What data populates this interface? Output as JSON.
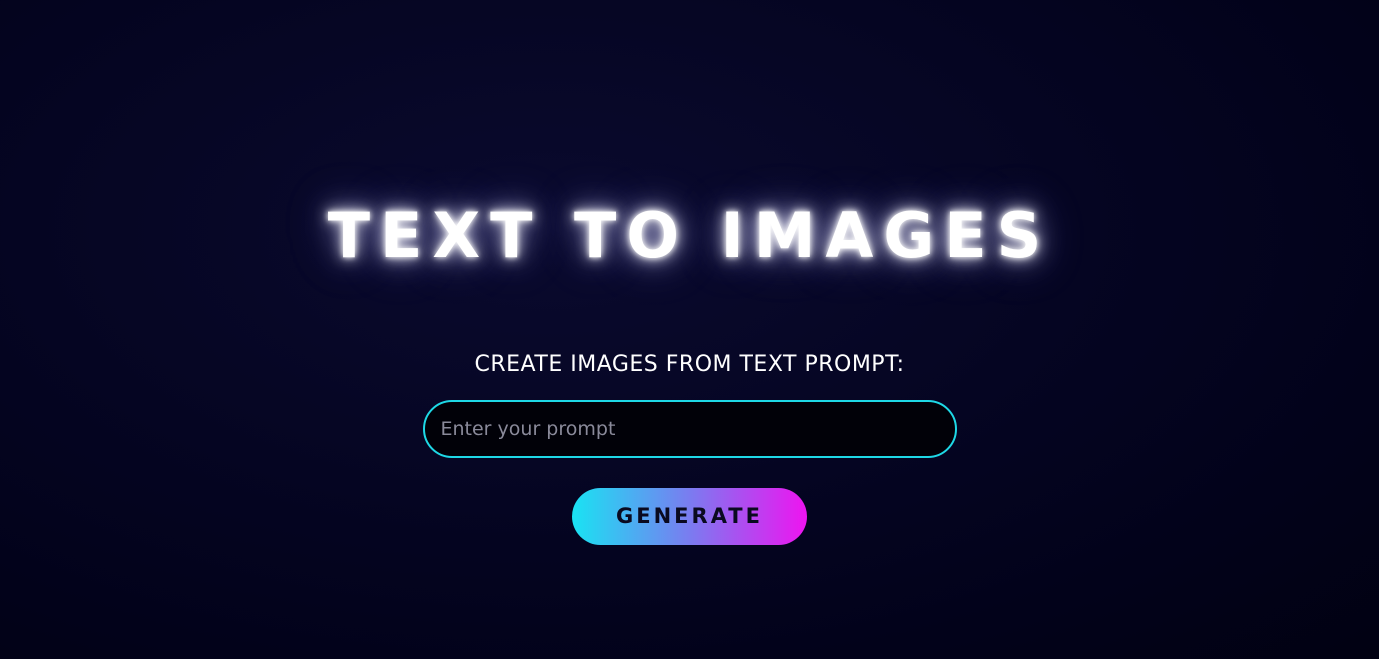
{
  "header": {
    "title": "TEXT TO IMAGES",
    "subtitle": "CREATE IMAGES FROM TEXT PROMPT:"
  },
  "form": {
    "prompt_value": "",
    "prompt_placeholder": "Enter your prompt",
    "generate_label": "GENERATE"
  },
  "colors": {
    "background": "#03031f",
    "input_border": "#1ed8e6",
    "button_gradient_start": "#19e3f3",
    "button_gradient_end": "#ee14f0"
  }
}
